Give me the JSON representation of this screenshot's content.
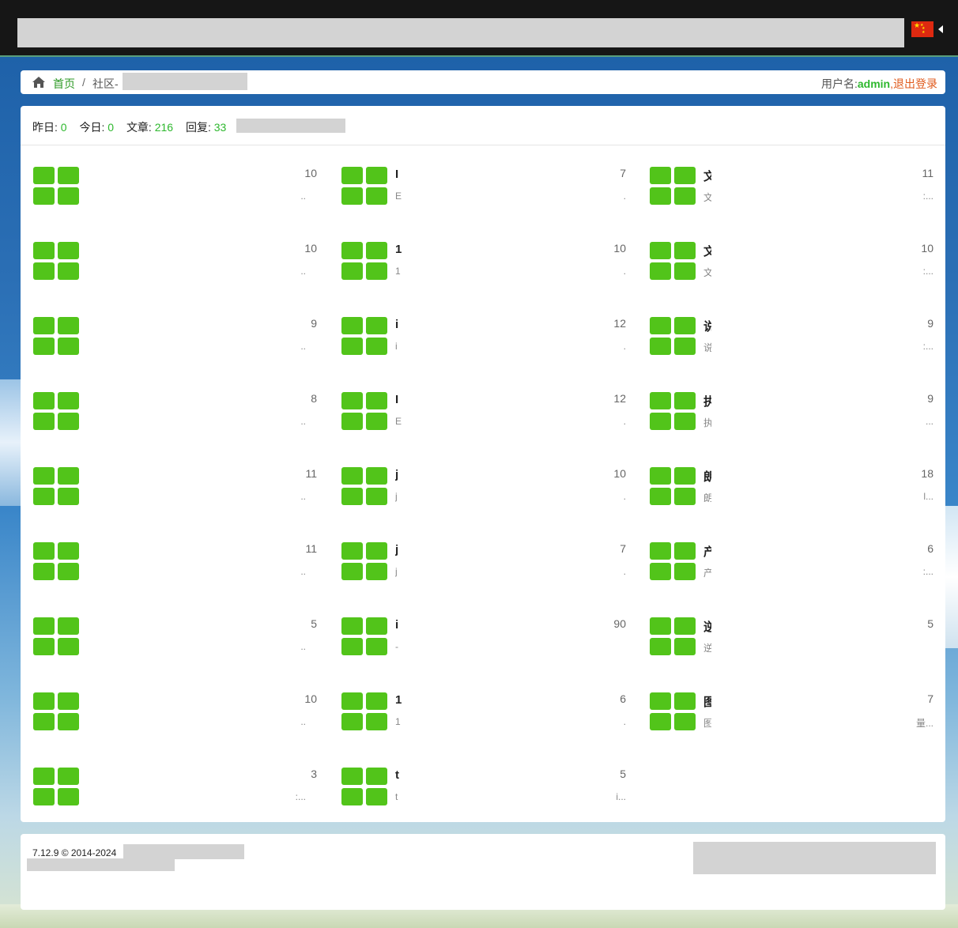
{
  "topbar": {
    "language_flag": "china-flag-icon"
  },
  "breadcrumb": {
    "home_label": "首页",
    "separator": "/",
    "current_label": "社区-"
  },
  "user": {
    "label": "用户名:",
    "name": "admin",
    "comma": ",",
    "logout_label": "退出登录"
  },
  "stats": {
    "yesterday_label": "昨日:",
    "yesterday_value": "0",
    "today_label": "今日:",
    "today_value": "0",
    "articles_label": "文章:",
    "articles_value": "216",
    "replies_label": "回复:",
    "replies_value": "33"
  },
  "forums": [
    [
      {
        "name": "",
        "desc": "",
        "count": "10",
        "dots": ".."
      },
      {
        "name": "",
        "desc": "",
        "count": "10",
        "dots": ".."
      },
      {
        "name": "",
        "desc": "",
        "count": "9",
        "dots": ".."
      },
      {
        "name": "",
        "desc": "",
        "count": "8",
        "dots": ".."
      },
      {
        "name": "",
        "desc": "",
        "count": "11",
        "dots": ".."
      },
      {
        "name": "",
        "desc": "",
        "count": "11",
        "dots": ".."
      },
      {
        "name": "",
        "desc": "",
        "count": "5",
        "dots": ".."
      },
      {
        "name": "",
        "desc": "",
        "count": "10",
        "dots": ".."
      },
      {
        "name": "",
        "desc": "",
        "count": "3",
        "dots": ":..."
      }
    ],
    [
      {
        "name": "I",
        "desc": "E",
        "count": "7",
        "dots": "."
      },
      {
        "name": "1",
        "desc": "1",
        "count": "10",
        "dots": "."
      },
      {
        "name": "i",
        "desc": "i",
        "count": "12",
        "dots": "."
      },
      {
        "name": "I",
        "desc": "E",
        "count": "12",
        "dots": "."
      },
      {
        "name": "j",
        "desc": "j",
        "count": "10",
        "dots": "."
      },
      {
        "name": "j",
        "desc": "j",
        "count": "7",
        "dots": "."
      },
      {
        "name": "i",
        "desc": "-",
        "count": "90",
        "dots": ""
      },
      {
        "name": "1",
        "desc": "1",
        "count": "6",
        "dots": "."
      },
      {
        "name": "t",
        "desc": "t",
        "count": "5",
        "dots": "i..."
      }
    ],
    [
      {
        "name": "文",
        "desc": "文",
        "count": "11",
        "dots": ":..."
      },
      {
        "name": "文",
        "desc": "文",
        "count": "10",
        "dots": ":..."
      },
      {
        "name": "说",
        "desc": "说",
        "count": "9",
        "dots": ":..."
      },
      {
        "name": "执",
        "desc": "执",
        "count": "9",
        "dots": "..."
      },
      {
        "name": "朗",
        "desc": "朗",
        "count": "18",
        "dots": "l..."
      },
      {
        "name": "产",
        "desc": "产",
        "count": "6",
        "dots": ":..."
      },
      {
        "name": "逆",
        "desc": "逆",
        "count": "5",
        "dots": ""
      },
      {
        "name": "图",
        "desc": "图",
        "count": "7",
        "dots": "量..."
      }
    ]
  ],
  "footer": {
    "version": "7.12.9 © 2014-2024"
  },
  "icons": {
    "home": "home-icon",
    "forum_tile": "grid-icon"
  },
  "colors": {
    "accent_green": "#52c41a",
    "link_green": "#2e9a26",
    "logout_orange": "#e05a1c"
  }
}
